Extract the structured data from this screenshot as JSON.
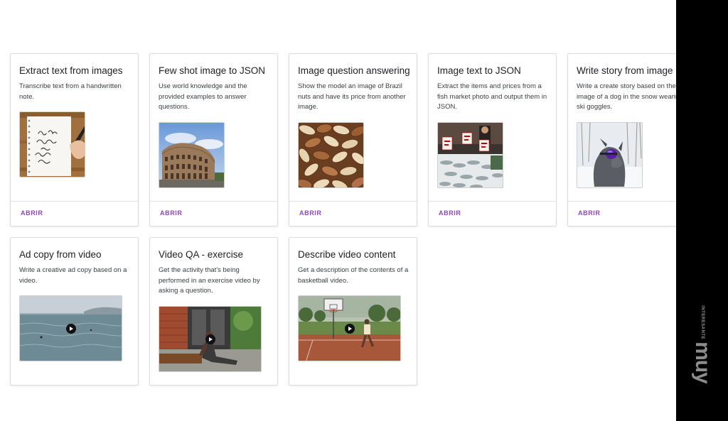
{
  "accent_color": "#8e44c8",
  "open_label": "ABRIR",
  "cards": [
    {
      "title": "Extract text from images",
      "desc": "Transcribe text from a handwritten note.",
      "image": "handwritten-note-image"
    },
    {
      "title": "Few shot image to JSON",
      "desc": "Use world knowledge and the provided examples to answer questions.",
      "image": "colosseum-image"
    },
    {
      "title": "Image question answering",
      "desc": "Show the model an image of Brazil nuts and have its price from another image.",
      "image": "brazil-nuts-image"
    },
    {
      "title": "Image text to JSON",
      "desc": "Extract the items and prices from a fish market photo and output them in JSON.",
      "image": "fish-market-image"
    },
    {
      "title": "Write story from image",
      "desc": "Write a create story based on the image of a dog in the snow wearing ski goggles.",
      "image": "dog-snow-image"
    },
    {
      "title": "Ad copy from video",
      "desc": "Write a creative ad copy based on a video.",
      "image": "ocean-video-thumbnail"
    },
    {
      "title": "Video QA - exercise",
      "desc": "Get the activity that's being performed in an exercise video by asking a question.",
      "image": "exercise-video-thumbnail"
    },
    {
      "title": "Describe video content",
      "desc": "Get a description of the contents of a basketball video.",
      "image": "basketball-video-thumbnail"
    }
  ],
  "watermark": {
    "main": "muy",
    "sub": "INTERESANTE"
  }
}
